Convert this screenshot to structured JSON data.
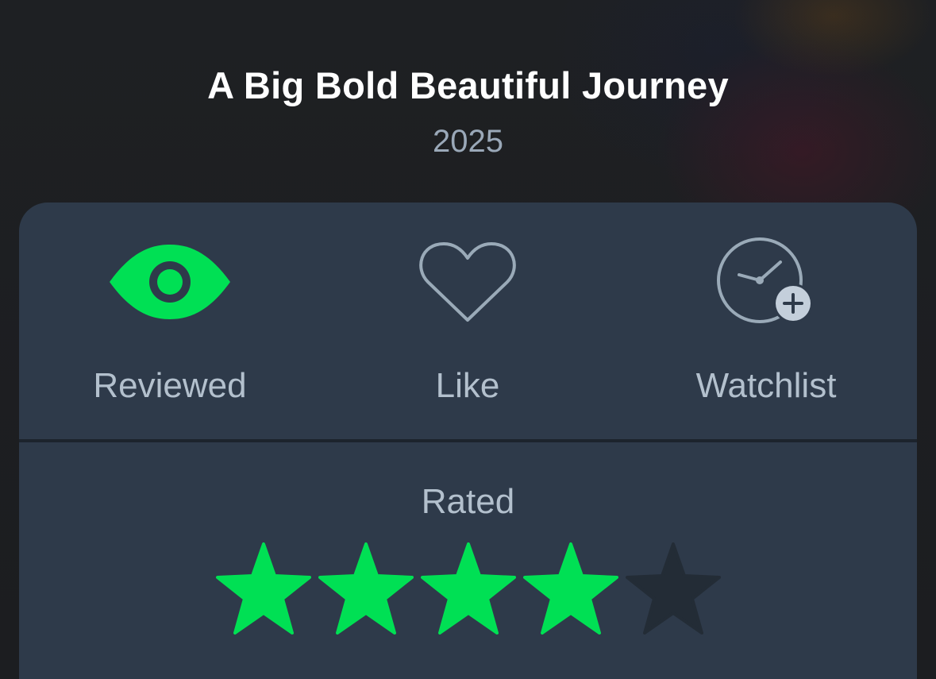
{
  "film": {
    "title": "A Big Bold Beautiful Journey",
    "year": "2025"
  },
  "actions": [
    {
      "id": "reviewed",
      "label": "Reviewed",
      "icon": "eye-icon",
      "active": true
    },
    {
      "id": "like",
      "label": "Like",
      "icon": "heart-icon",
      "active": false
    },
    {
      "id": "watchlist",
      "label": "Watchlist",
      "icon": "clock-plus-icon",
      "active": false
    }
  ],
  "rating": {
    "label": "Rated",
    "value": 4,
    "max": 5
  },
  "colors": {
    "accent": "#00e054",
    "panel": "#2e3a4a",
    "muted_text": "#b3c0cd",
    "inactive_icon": "#9aaab8",
    "empty_star": "#232c36"
  }
}
